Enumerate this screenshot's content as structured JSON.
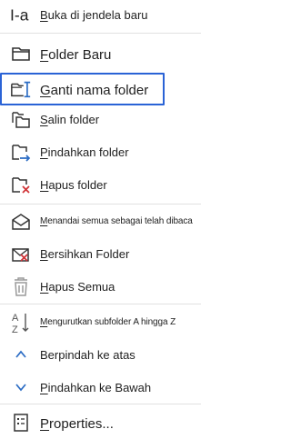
{
  "menu": {
    "items": [
      {
        "id": "open-new-window",
        "icon": "open-in-new-window-icon",
        "label_pre": "",
        "label_acc": "B",
        "label_post": "uka di jendela baru"
      },
      {
        "id": "new-folder",
        "icon": "new-folder-icon",
        "label_pre": "",
        "label_acc": "F",
        "label_post": "older Baru"
      },
      {
        "id": "rename-folder",
        "icon": "rename-folder-icon",
        "label_pre": "",
        "label_acc": "G",
        "label_post": "anti nama folder"
      },
      {
        "id": "copy-folder",
        "icon": "copy-folder-icon",
        "label_pre": "",
        "label_acc": "S",
        "label_post": "alin folder"
      },
      {
        "id": "move-folder",
        "icon": "move-folder-icon",
        "label_pre": "",
        "label_acc": "P",
        "label_post": "indahkan folder"
      },
      {
        "id": "delete-folder",
        "icon": "delete-folder-icon",
        "label_pre": "",
        "label_acc": "H",
        "label_post": "apus folder"
      },
      {
        "id": "mark-all-read",
        "icon": "mark-all-read-icon",
        "label_pre": "",
        "label_acc": "M",
        "label_post": "enandai semua sebagai telah dibaca"
      },
      {
        "id": "clean-up-folder",
        "icon": "clean-up-folder-icon",
        "label_pre": "",
        "label_acc": "B",
        "label_post": "ersihkan Folder"
      },
      {
        "id": "delete-all",
        "icon": "delete-all-icon",
        "label_pre": "",
        "label_acc": "H",
        "label_post": "apus Semua"
      },
      {
        "id": "sort-subfolders",
        "icon": "sort-a-to-z-icon",
        "label_pre": "",
        "label_acc": "M",
        "label_post": "engurutkan subfolder A hingga Z"
      },
      {
        "id": "move-up",
        "icon": "chevron-up-icon",
        "label_pre": "Berpindah ke atas",
        "label_acc": "",
        "label_post": ""
      },
      {
        "id": "move-down",
        "icon": "chevron-down-icon",
        "label_pre": "",
        "label_acc": "P",
        "label_post": "indahkan ke Bawah"
      },
      {
        "id": "properties",
        "icon": "properties-icon",
        "label_pre": "",
        "label_acc": "P",
        "label_post": "roperties..."
      }
    ],
    "colors": {
      "highlight_border": "#2a63d6",
      "arrow_blue": "#2b6cc4",
      "delete_red": "#d13438",
      "icon_gray": "#444444",
      "text": "#1f1f1f"
    }
  }
}
